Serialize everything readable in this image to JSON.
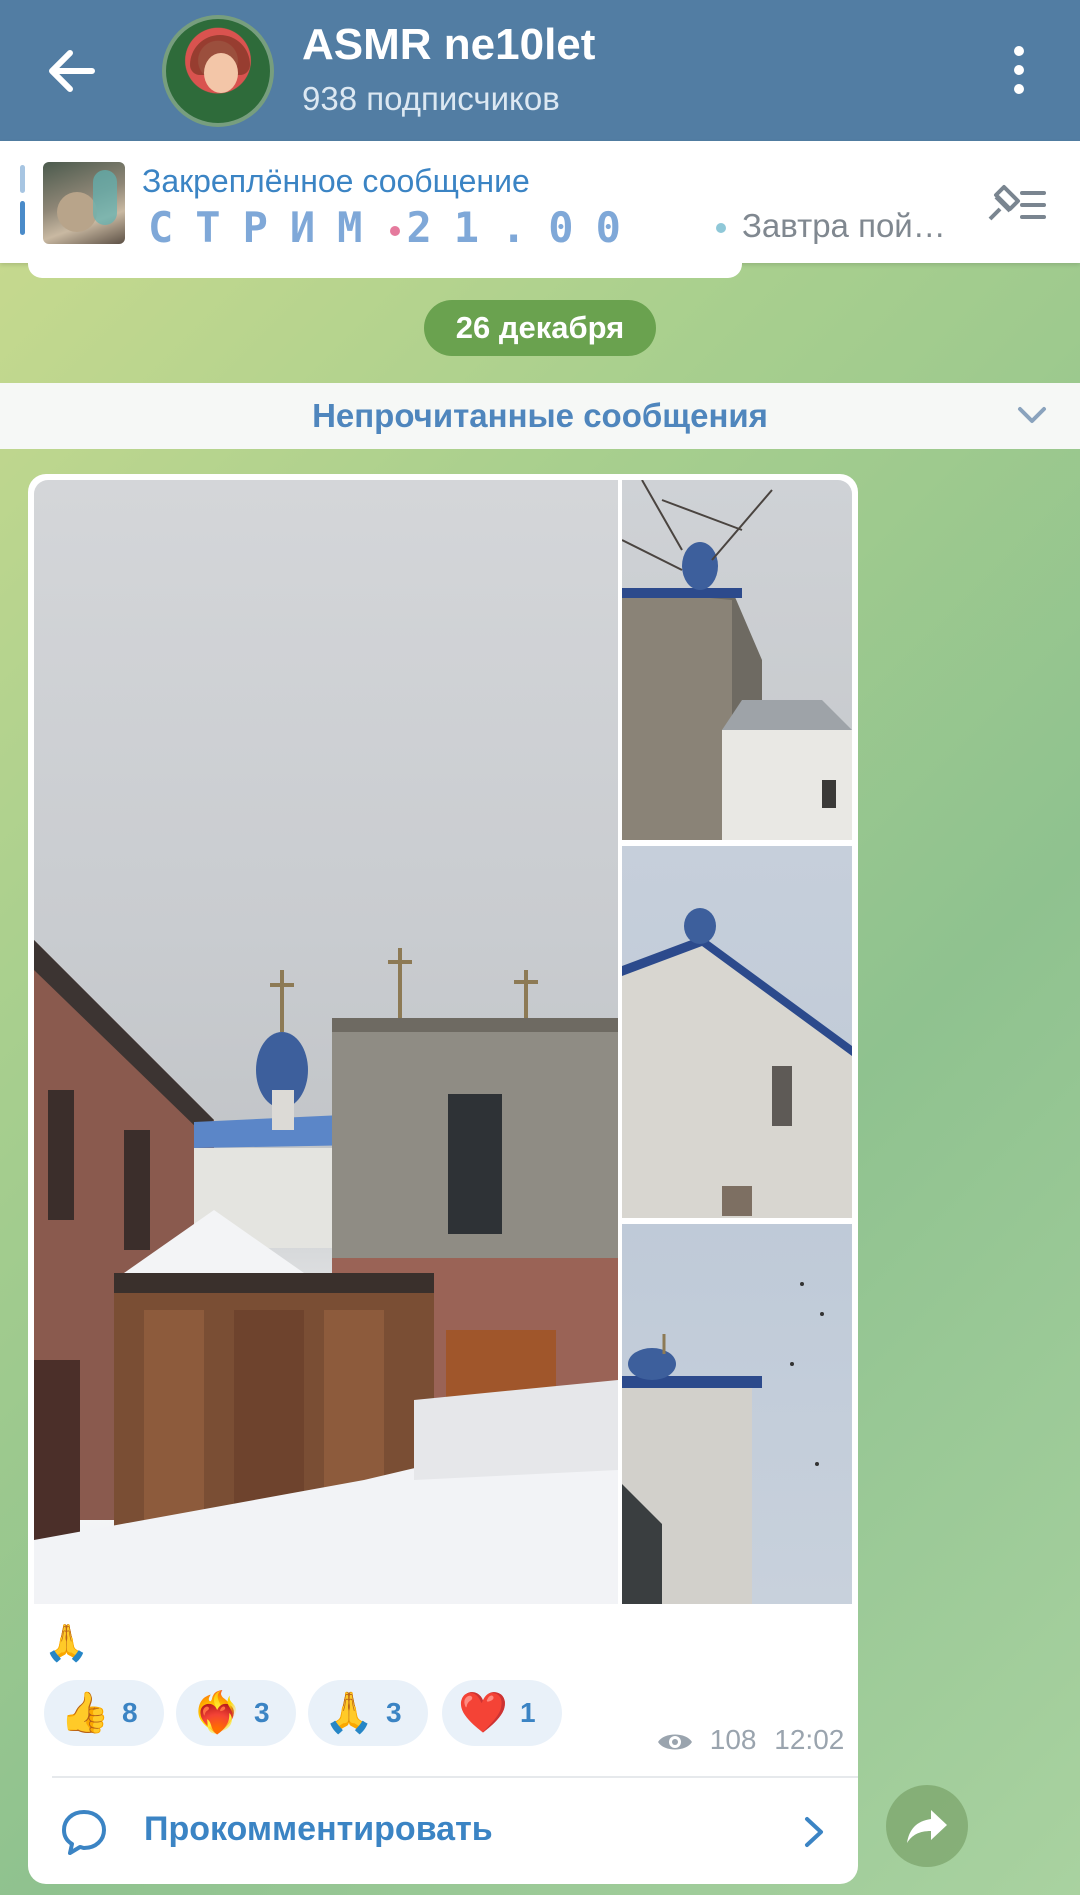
{
  "header": {
    "title": "ASMR ne10let",
    "subtitle": "938 подписчиков"
  },
  "pinned": {
    "label": "Закреплённое сообщение",
    "text_part1": "СТРИМ",
    "text_part2": "21.00",
    "text_tail": "Завтра пой…"
  },
  "feed": {
    "date": "26 декабря",
    "unread_label": "Непрочитанные сообщения"
  },
  "post": {
    "caption_emoji": "🙏",
    "reactions": [
      {
        "emoji": "👍",
        "count": "8",
        "icon": "thumbs-up-icon"
      },
      {
        "emoji": "❤️‍🔥",
        "count": "3",
        "icon": "heart-on-fire-icon"
      },
      {
        "emoji": "🙏",
        "count": "3",
        "icon": "folded-hands-icon"
      },
      {
        "emoji": "❤️",
        "count": "1",
        "icon": "red-heart-icon"
      }
    ],
    "views": "108",
    "time": "12:02",
    "comment_label": "Прокомментировать"
  },
  "colors": {
    "header_bg": "#527da3",
    "accent_blue": "#3b84c4",
    "date_pill": "#6aa24f"
  }
}
